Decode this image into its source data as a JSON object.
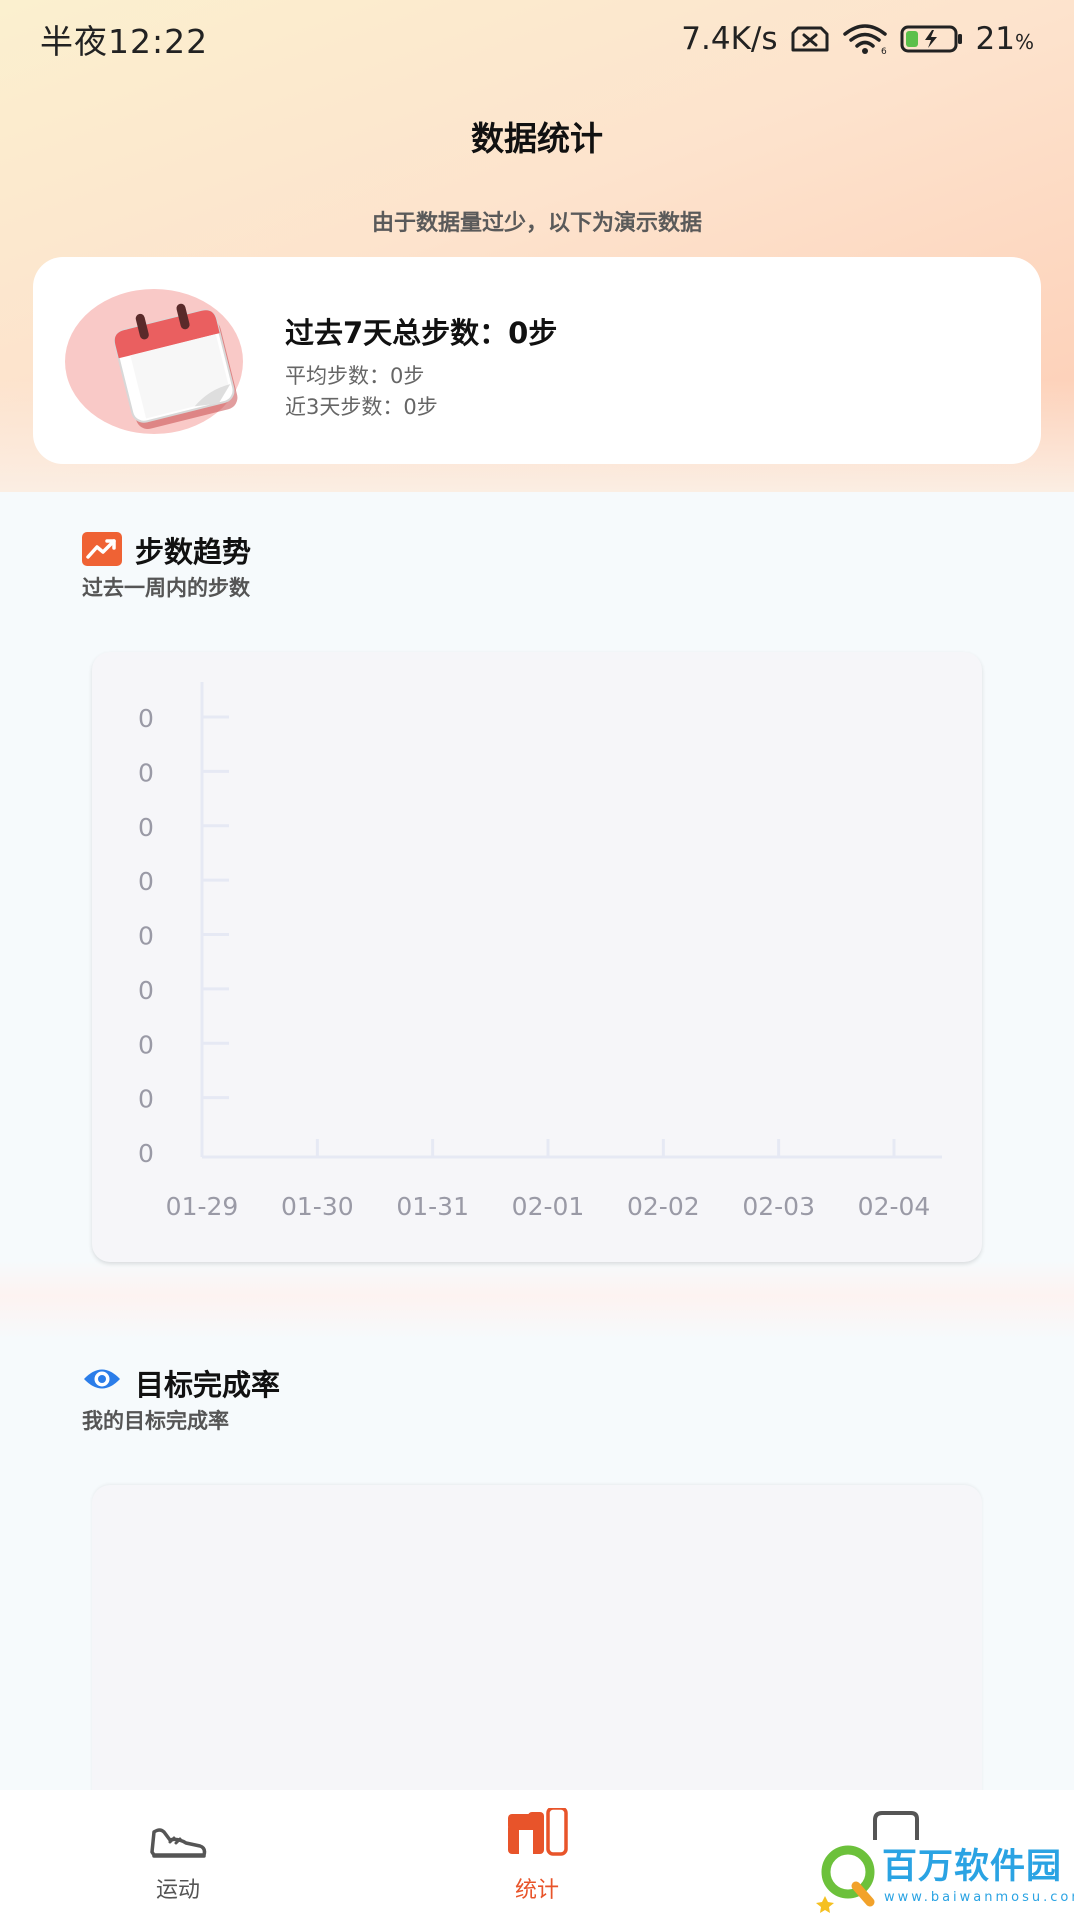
{
  "status_bar": {
    "time": "半夜12:22",
    "network_speed": "7.4K/s",
    "battery_percent": "21",
    "battery_unit": "%",
    "icons": [
      "no-sim-icon",
      "wifi-icon",
      "battery-charging-icon"
    ]
  },
  "header": {
    "title": "数据统计",
    "notice": "由于数据量过少，以下为演示数据"
  },
  "summary": {
    "icon": "calendar-icon",
    "total": "过去7天总步数：0步",
    "average": "平均步数：0步",
    "recent": "近3天步数：0步"
  },
  "trend_section": {
    "icon": "trend-up-icon",
    "title": "步数趋势",
    "subtitle": "过去一周内的步数"
  },
  "chart_data": {
    "type": "bar",
    "categories": [
      "01-29",
      "01-30",
      "01-31",
      "02-01",
      "02-02",
      "02-03",
      "02-04"
    ],
    "values": [
      0,
      0,
      0,
      0,
      0,
      0,
      0
    ],
    "y_tick_labels": [
      "0",
      "0",
      "0",
      "0",
      "0",
      "0",
      "0",
      "0",
      "0"
    ],
    "grid": false
  },
  "goal_section": {
    "icon": "eye-icon",
    "title": "目标完成率",
    "subtitle": "我的目标完成率"
  },
  "tab_bar": {
    "active_color": "#e8542a",
    "inactive_color": "#555555",
    "items": [
      {
        "label": "运动",
        "icon": "sneaker-icon",
        "active": false
      },
      {
        "label": "统计",
        "icon": "bar-chart-icon",
        "active": true
      },
      {
        "label": "",
        "icon": "message-icon",
        "active": false
      }
    ]
  },
  "watermark": {
    "text": "百万软件园",
    "url": "www.baiwanmosu.com"
  },
  "colors": {
    "accent": "#e8542a",
    "eye_icon": "#2b7de9",
    "chart_text": "#9a9aa6"
  }
}
